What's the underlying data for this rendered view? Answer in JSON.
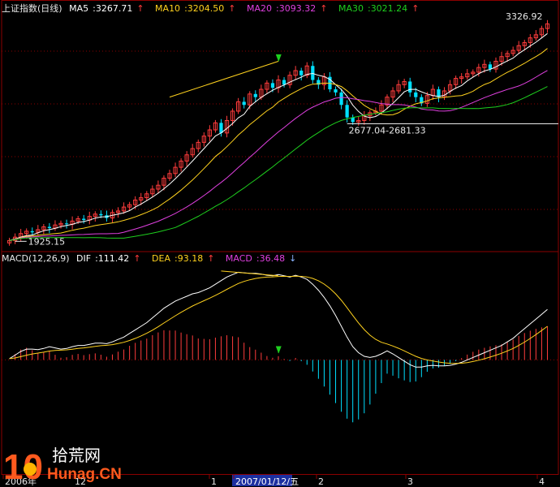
{
  "chart_data": [
    {
      "type": "candlestick",
      "title": "上证指数(日线)",
      "indicators": [
        {
          "name": "MA5",
          "value": "3267.71",
          "color": "#ffffff"
        },
        {
          "name": "MA10",
          "value": "3204.50",
          "color": "#ffd21e"
        },
        {
          "name": "MA20",
          "value": "3093.32",
          "color": "#e040e0"
        },
        {
          "name": "MA30",
          "value": "3021.24",
          "color": "#1ecf1e"
        }
      ],
      "annotations": {
        "low_label": "1925.15",
        "mid_range_label": "2677.04-2681.33",
        "high_label": "3326.92"
      },
      "ylim": [
        1880,
        3400
      ],
      "close": [
        1930,
        1952,
        1975,
        1990,
        1983,
        2000,
        2018,
        2010,
        2030,
        2040,
        2035,
        2055,
        2070,
        2062,
        2085,
        2100,
        2092,
        2075,
        2110,
        2120,
        2145,
        2160,
        2190,
        2205,
        2230,
        2260,
        2285,
        2330,
        2360,
        2400,
        2440,
        2480,
        2520,
        2560,
        2600,
        2640,
        2685,
        2620,
        2700,
        2760,
        2820,
        2800,
        2870,
        2850,
        2900,
        2940,
        2910,
        2960,
        2930,
        2990,
        3020,
        2990,
        3050,
        2960,
        2930,
        2980,
        2900,
        2880,
        2800,
        2720,
        2690,
        2700,
        2730,
        2750,
        2760,
        2800,
        2850,
        2890,
        2930,
        2950,
        2880,
        2850,
        2810,
        2860,
        2900,
        2850,
        2890,
        2930,
        2970,
        2980,
        3000,
        3010,
        3040,
        3060,
        3030,
        3080,
        3110,
        3130,
        3150,
        3180,
        3200,
        3230,
        3250,
        3290,
        3320
      ]
    },
    {
      "type": "macd",
      "title": "MACD(12,26,9)",
      "indicators": [
        {
          "name": "DIF",
          "value": "111.42",
          "color": "#ffffff"
        },
        {
          "name": "DEA",
          "value": "93.18",
          "color": "#ffd21e"
        },
        {
          "name": "MACD",
          "value": "36.48",
          "color": "#e040e0"
        }
      ],
      "ylim": [
        -190,
        160
      ],
      "dif": [
        2,
        8,
        14,
        18,
        18,
        17,
        19,
        22,
        20,
        18,
        19,
        22,
        24,
        24,
        26,
        28,
        28,
        27,
        30,
        34,
        38,
        44,
        50,
        56,
        62,
        70,
        78,
        86,
        92,
        98,
        102,
        106,
        110,
        112,
        116,
        120,
        126,
        132,
        138,
        142,
        146,
        145,
        144,
        144,
        143,
        141,
        140,
        142,
        140,
        138,
        141,
        138,
        134,
        126,
        116,
        104,
        90,
        74,
        56,
        38,
        22,
        12,
        6,
        4,
        6,
        10,
        15,
        10,
        4,
        -2,
        -8,
        -12,
        -12,
        -10,
        -9,
        -10,
        -10,
        -9,
        -7,
        -4,
        0,
        4,
        8,
        12,
        16,
        20,
        24,
        30,
        36,
        44,
        52,
        60,
        68,
        76,
        84
      ]
    },
    {
      "type": "axis",
      "x_tick_labels": [
        "2006年",
        "12",
        "1",
        "2007/01/12/五",
        "2",
        "3",
        "4"
      ]
    }
  ],
  "colors": {
    "up": "#ff3c3c",
    "down": "#00e0ff",
    "grid": "#8b0000",
    "text": "#e8e8e8"
  },
  "watermark": {
    "big": "10",
    "cn": "拾荒网",
    "url": "Hunag.CN"
  }
}
